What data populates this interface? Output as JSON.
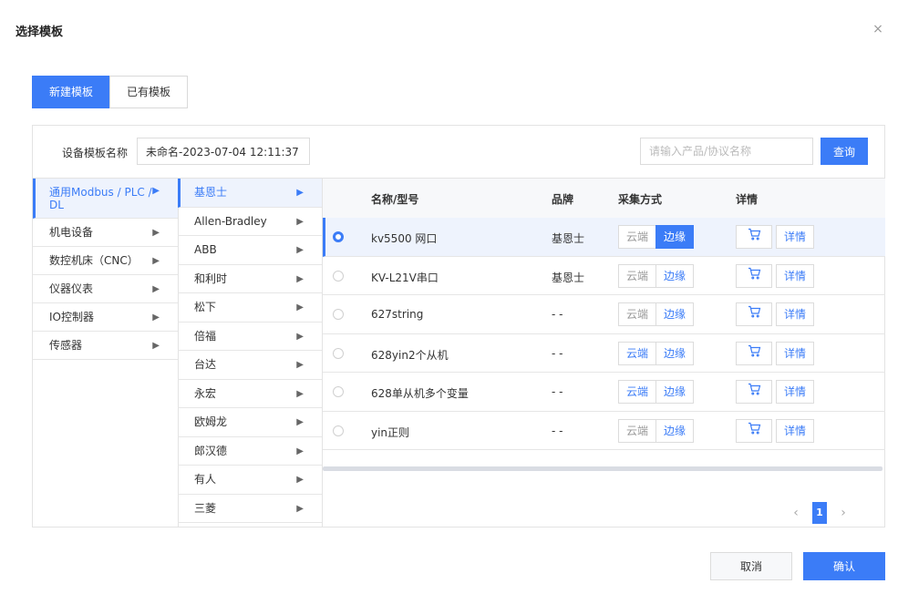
{
  "dialog": {
    "title": "选择模板",
    "close_icon": "×"
  },
  "mode_tabs": [
    {
      "label": "新建模板",
      "active": true
    },
    {
      "label": "已有模板",
      "active": false
    }
  ],
  "form": {
    "name_label": "设备模板名称",
    "name_value": "未命名-2023-07-04 12:11:37",
    "search_placeholder": "请输入产品/协议名称",
    "search_button": "查询"
  },
  "categories": [
    {
      "label": "通用Modbus / PLC / DL",
      "active": true
    },
    {
      "label": "机电设备",
      "active": false
    },
    {
      "label": "数控机床（CNC）",
      "active": false
    },
    {
      "label": "仪器仪表",
      "active": false
    },
    {
      "label": "IO控制器",
      "active": false
    },
    {
      "label": "传感器",
      "active": false
    }
  ],
  "brands": [
    {
      "label": "基恩士",
      "active": true
    },
    {
      "label": "Allen-Bradley",
      "active": false
    },
    {
      "label": "ABB",
      "active": false
    },
    {
      "label": "和利时",
      "active": false
    },
    {
      "label": "松下",
      "active": false
    },
    {
      "label": "倍福",
      "active": false
    },
    {
      "label": "台达",
      "active": false
    },
    {
      "label": "永宏",
      "active": false
    },
    {
      "label": "欧姆龙",
      "active": false
    },
    {
      "label": "郎汉德",
      "active": false
    },
    {
      "label": "有人",
      "active": false
    },
    {
      "label": "三菱",
      "active": false
    }
  ],
  "table": {
    "headers": {
      "name": "名称/型号",
      "brand": "品牌",
      "method": "采集方式",
      "detail": "详情"
    },
    "rows": [
      {
        "name": "kv5500 网口",
        "brand": "基恩士",
        "selected": true,
        "cloud": "云端",
        "edge": "边缘",
        "cloud_enabled": false,
        "edge_selected": true,
        "detail": "详情"
      },
      {
        "name": "KV-L21V串口",
        "brand": "基恩士",
        "selected": false,
        "cloud": "云端",
        "edge": "边缘",
        "cloud_enabled": false,
        "edge_selected": false,
        "detail": "详情"
      },
      {
        "name": "627string",
        "brand": "- -",
        "selected": false,
        "cloud": "云端",
        "edge": "边缘",
        "cloud_enabled": false,
        "edge_selected": false,
        "detail": "详情"
      },
      {
        "name": "628yin2个从机",
        "brand": "- -",
        "selected": false,
        "cloud": "云端",
        "edge": "边缘",
        "cloud_enabled": true,
        "edge_selected": false,
        "detail": "详情"
      },
      {
        "name": "628单从机多个变量",
        "brand": "- -",
        "selected": false,
        "cloud": "云端",
        "edge": "边缘",
        "cloud_enabled": true,
        "edge_selected": false,
        "detail": "详情"
      },
      {
        "name": "yin正则",
        "brand": "- -",
        "selected": false,
        "cloud": "云端",
        "edge": "边缘",
        "cloud_enabled": false,
        "edge_selected": false,
        "detail": "详情"
      }
    ]
  },
  "pagination": {
    "prev": "‹",
    "current": "1",
    "next": "›"
  },
  "footer": {
    "cancel": "取消",
    "confirm": "确认"
  },
  "colors": {
    "primary": "#3b7cf7",
    "selected_bg": "#eef3fd"
  }
}
